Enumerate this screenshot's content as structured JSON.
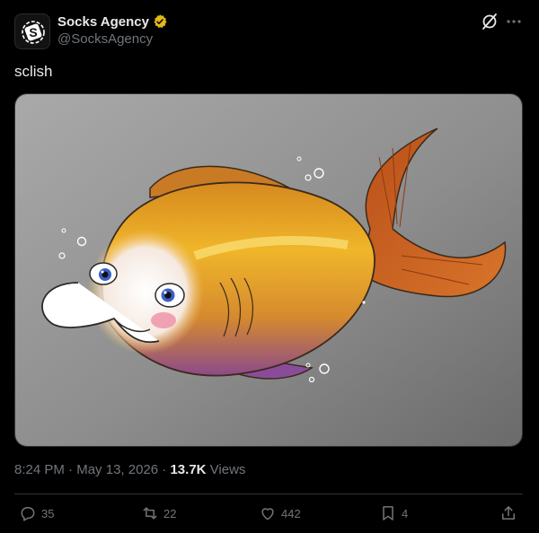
{
  "author": {
    "display_name": "Socks Agency",
    "handle": "@SocksAgency",
    "avatar_icon": "socks-logo-icon",
    "verified_icon": "verified-gold-badge-icon",
    "verified_color": "#e2b719"
  },
  "header_icons": [
    "grok-icon",
    "more-options-icon"
  ],
  "tweet": {
    "text": "sclish",
    "media_icon": "fish-illustration-image"
  },
  "meta": {
    "time": "8:24 PM",
    "sep1": "·",
    "date": "May 13, 2026",
    "sep2": "·",
    "views_count": "13.7K",
    "views_label": "Views"
  },
  "actions": {
    "reply": {
      "icon": "reply-icon",
      "count": "35"
    },
    "repost": {
      "icon": "repost-icon",
      "count": "22"
    },
    "like": {
      "icon": "heart-icon",
      "count": "442"
    },
    "bookmark": {
      "icon": "bookmark-icon",
      "count": "4"
    },
    "share": {
      "icon": "share-icon"
    }
  },
  "colors": {
    "background": "#000000",
    "text_primary": "#e7e9ea",
    "text_secondary": "#71767b",
    "border": "#2f3336"
  }
}
